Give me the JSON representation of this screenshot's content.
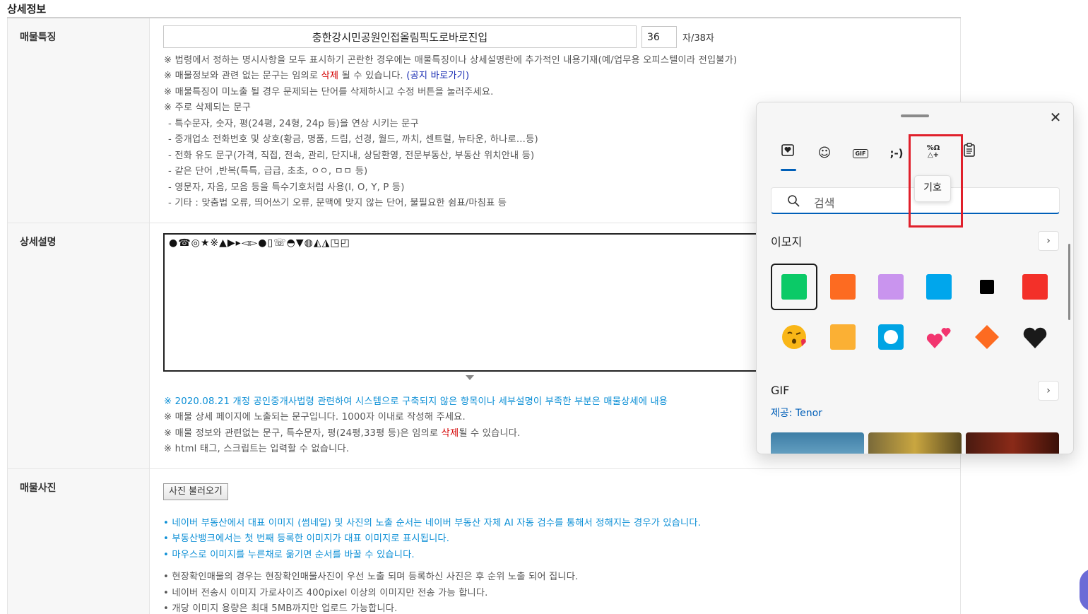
{
  "section": {
    "title": "상세정보"
  },
  "row_features": {
    "label": "매물특징",
    "title_value": "충한강시민공원인접올림픽도로바로진입",
    "char_count": "36",
    "char_suffix": "자/38자",
    "notes": [
      "※ 법령에서 정하는 명시사항을 모두 표시하기 곤란한 경우에는 매물특징이나 상세설명란에 추가적인 내용기재(예/업무용 오피스텔이라 전입불가)",
      "※ 주로 삭제되는 문구",
      "※ 매물특징이 미노출 될 경우 문제되는 단어를 삭제하시고 수정 버튼을 눌러주세요.",
      "- 특수문자, 숫자, 평(24평, 24형, 24p 등)을 연상 시키는 문구",
      "- 중개업소 전화번호 및 상호(황금, 명품, 드림, 선경, 월드, 까치, 센트럴, 뉴타운, 하나로…등)",
      "- 전화 유도 문구(가격, 직접, 전속, 관리, 단지내, 상담환영, 전문부동산, 부동산 위치안내 등)",
      "- 같은 단어 ,반복(특특, 급급, 초초, ㅇㅇ, ㅁㅁ 등)",
      "- 영문자, 자음, 모음 등을 특수기호처럼 사용(I, O, Y, P 등)",
      "- 기타 : 맞춤법 오류, 띄어쓰기 오류, 문맥에 맞지 않는 단어, 불필요한 쉼표/마침표 등"
    ],
    "note_info_prefix": "※ 매물정보와 관련 없는 문구는 임의로 ",
    "note_info_red": "삭제",
    "note_info_mid": " 될 수 있습니다. ",
    "note_info_link": "(공지 바로가기)"
  },
  "row_desc": {
    "label": "상세설명",
    "textarea_value": "●☎◎★※▲▶▸◅▻●▯☏◓▼◍◭◮◳◰",
    "notice_blue": "※ 2020.08.21 개정 공인중개사법령 관련하여 시스템으로 구축되지 않은 항목이나 세부설명이 부족한 부분은 매물상세에 내용",
    "note2": "※ 매물 상세 페이지에 노출되는 문구입니다. 1000자 이내로 작성해 주세요.",
    "note3_prefix": "※ 매물 정보와 관련없는 문구, 특수문자, 평(24평,33평 등)은 임의로 ",
    "note3_red": "삭제",
    "note3_suffix": "될 수 있습니다.",
    "note4": "※ html 태그, 스크립트는 입력할 수 없습니다."
  },
  "row_photo": {
    "label": "매물사진",
    "button_label": "사진 불러오기",
    "blue_notes": [
      "• 네이버 부동산에서 대표 이미지 (썸네일) 및 사진의 노출 순서는 네이버 부동산 자체 AI 자동 검수를 통해서 정해지는 경우가 있습니다.",
      "• 부동산뱅크에서는 첫 번째 등록한 이미지가 대표 이미지로 표시됩니다.",
      "• 마우스로 이미지를 누른채로 옮기면 순서를 바꿀 수 있습니다."
    ],
    "gray_notes": [
      "• 현장확인매물의 경우는 현장확인매물사진이 우선 노출 되며 등록하신 사진은 후 순위 노출 되어 집니다.",
      "• 네이버 전송시 이미지 가로사이즈 400pixel 이상의 이미지만 전송 가능 합니다.",
      "• 개당 이미지 용량은 최대 5MB까지만 업로드 가능합니다."
    ]
  },
  "emoji_panel": {
    "tabs": [
      {
        "name": "favorites-icon",
        "glyph": "♡"
      },
      {
        "name": "emoji-icon",
        "glyph": "☺"
      },
      {
        "name": "gif-icon",
        "glyph": "GIF"
      },
      {
        "name": "kaomoji-icon",
        "glyph": ";-)"
      },
      {
        "name": "symbols-icon",
        "glyph": "%Ω△+"
      },
      {
        "name": "clipboard-icon",
        "glyph": "📋"
      }
    ],
    "close_glyph": "✕",
    "search_placeholder": "검색",
    "tooltip": "기호",
    "emoji_section": "이모지",
    "gif_section": "GIF",
    "gif_provider": "제공: Tenor",
    "chevron": "›",
    "emoji_row1_colors": [
      "#0bca67",
      "#fd6b21",
      "#c994ee",
      "#00a6ec",
      "#000000",
      "#f33029"
    ],
    "emoji_row2": [
      "kissing-face-icon",
      "orange-square-icon",
      "blue-button-icon",
      "two-hearts-icon",
      "orange-diamond-icon",
      "black-heart-icon"
    ],
    "accent_color": "#005fb8",
    "highlight_color": "#e0202b"
  }
}
